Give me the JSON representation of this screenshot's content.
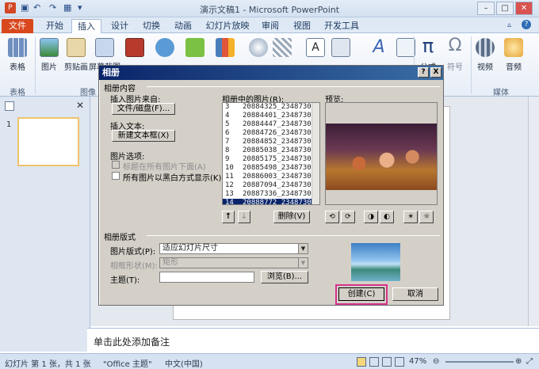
{
  "app": {
    "title": "演示文稿1 - Microsoft PowerPoint"
  },
  "ribbon": {
    "tabs": [
      {
        "label": "文件"
      },
      {
        "label": "开始"
      },
      {
        "label": "插入"
      },
      {
        "label": "设计"
      },
      {
        "label": "切换"
      },
      {
        "label": "动画"
      },
      {
        "label": "幻灯片放映"
      },
      {
        "label": "审阅"
      },
      {
        "label": "视图"
      },
      {
        "label": "开发工具"
      }
    ],
    "active_tab": "插入",
    "buttons": {
      "table": "表格",
      "picture": "图片",
      "clipart": "剪贴画",
      "screenshot": "屏幕截图",
      "formula": "公式",
      "symbol": "符号",
      "video": "视频",
      "audio": "音频"
    },
    "groups": {
      "tables": "表格",
      "images": "图像",
      "media": "媒体"
    }
  },
  "slide_pane": {
    "slide_number": "1"
  },
  "notes": {
    "placeholder": "单击此处添加备注"
  },
  "statusbar": {
    "slide_info": "幻灯片 第 1 张，共 1 张",
    "theme": "\"Office 主题\"",
    "language": "中文(中国)",
    "zoom": "47%"
  },
  "dialog": {
    "title": "相册",
    "help_button": "?",
    "close_button": "X",
    "album_content_label": "相册内容",
    "insert_from_label": "插入图片来自:",
    "file_disk_button": "文件/磁盘(F)...",
    "insert_text_label": "插入文本:",
    "new_textbox_button": "新建文本框(X)",
    "picture_options_label": "图片选项:",
    "caption_below_label": "标题在所有图片下面(A)",
    "black_white_label": "所有图片以黑白方式显示(K)",
    "pictures_in_album_label": "相册中的图片(R):",
    "picture_list": [
      {
        "num": "3",
        "name": "20884325_2348730"
      },
      {
        "num": "4",
        "name": "20884401_2348730"
      },
      {
        "num": "5",
        "name": "20884447_2348730"
      },
      {
        "num": "6",
        "name": "20884726_2348730"
      },
      {
        "num": "7",
        "name": "20884852_2348730"
      },
      {
        "num": "8",
        "name": "20885038_2348730"
      },
      {
        "num": "9",
        "name": "20885175_2348730"
      },
      {
        "num": "10",
        "name": "20885498_2348730"
      },
      {
        "num": "11",
        "name": "20886003_2348730"
      },
      {
        "num": "12",
        "name": "20887094_2348730"
      },
      {
        "num": "13",
        "name": "20887336_2348730"
      },
      {
        "num": "14",
        "name": "20888772_2348730"
      }
    ],
    "selected_picture": "14",
    "remove_button": "删除(V)",
    "preview_label": "预览:",
    "album_layout_label": "相册版式",
    "picture_layout_label": "图片版式(P):",
    "picture_layout_value": "适应幻灯片尺寸",
    "frame_shape_label": "相框形状(M):",
    "frame_shape_value": "矩形",
    "theme_label": "主题(T):",
    "theme_value": "",
    "browse_button": "浏览(B)...",
    "create_button": "创建(C)",
    "cancel_button": "取消",
    "move_up_symbol": "↑",
    "move_down_symbol": "↓"
  },
  "colors": {
    "file_tab": "#d9481d",
    "dialog_title": "#0a246a",
    "highlight_box": "#d6338a",
    "thumb_border": "#f0c36d"
  }
}
